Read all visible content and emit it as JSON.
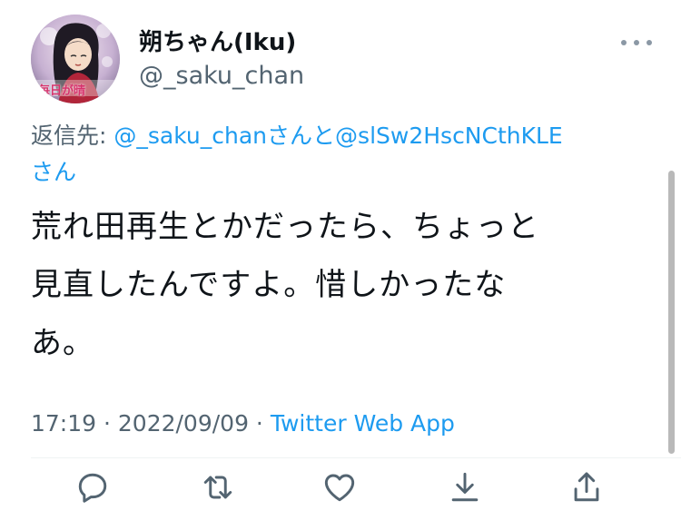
{
  "user": {
    "display_name": "朔ちゃん(Iku)",
    "handle": "@_saku_chan",
    "avatar_caption": "毎日が晴"
  },
  "reply": {
    "label": "返信先: ",
    "mention1": "@_saku_chan",
    "joiner": "さんと",
    "mention2": "@slSw2HscNCthKLE",
    "suffix": "さん"
  },
  "tweet": {
    "line1": "荒れ田再生とかだったら、ちょっと",
    "line2": "見直したんですよ。惜しかったな",
    "line3": "あ。"
  },
  "meta": {
    "time": "17:19",
    "date": "2022/09/09",
    "separator": " · ",
    "source": "Twitter Web App"
  },
  "colors": {
    "accent": "#1d9bf0",
    "secondary_text": "#536471",
    "icon": "#536471"
  },
  "icons": {
    "reply": "speech-bubble-icon",
    "retweet": "retweet-icon",
    "like": "heart-icon",
    "download": "download-icon",
    "share": "share-icon",
    "more": "more-dots-icon"
  }
}
